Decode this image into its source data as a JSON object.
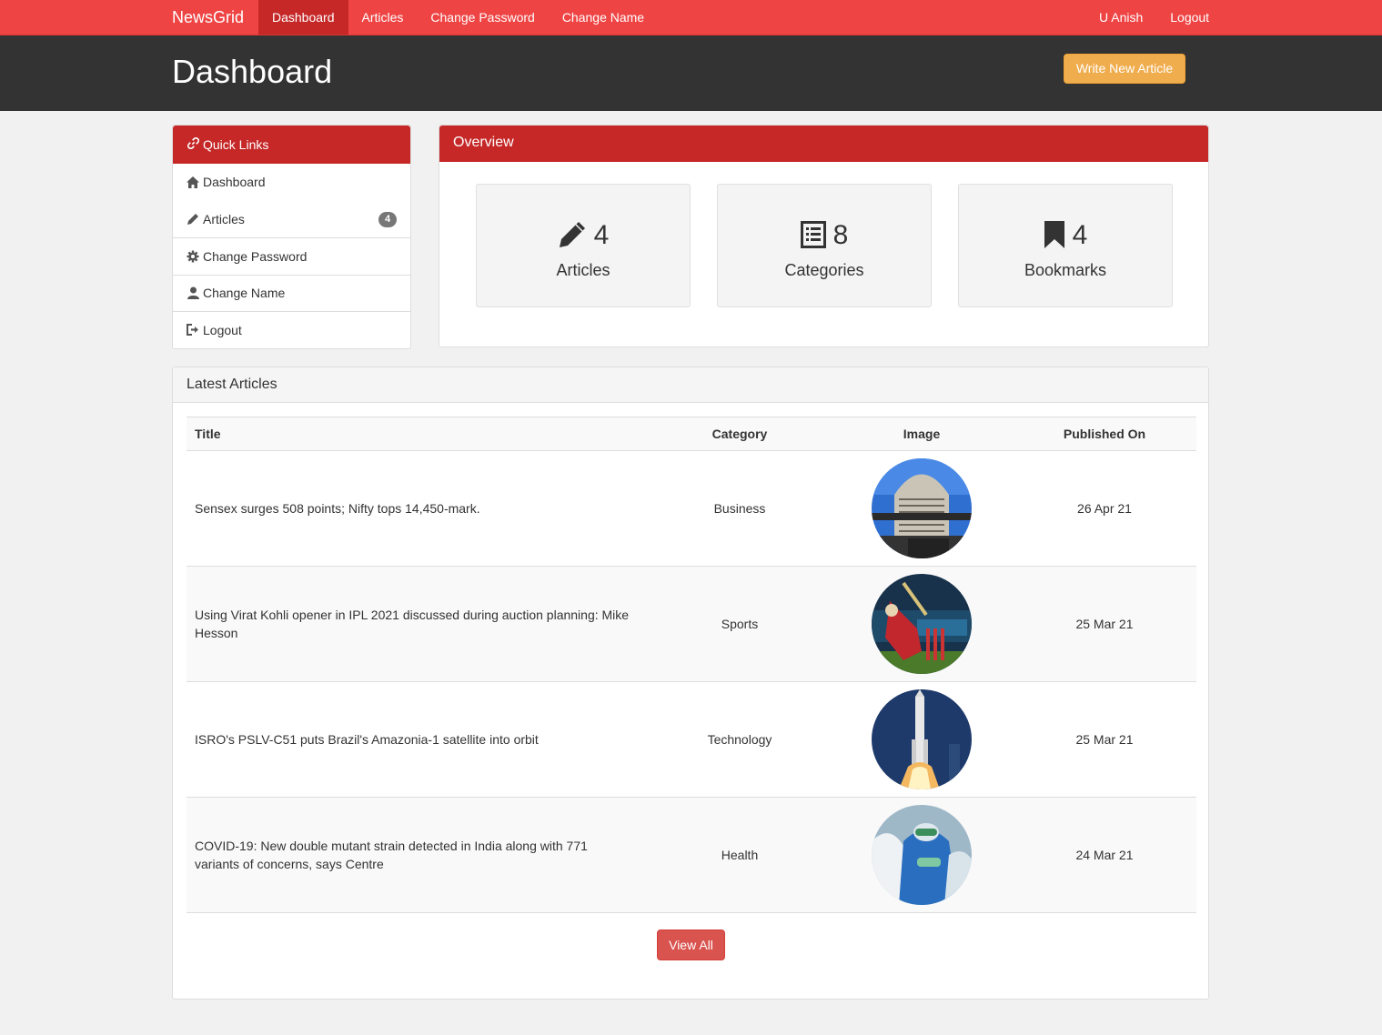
{
  "navbar": {
    "brand": "NewsGrid",
    "links": [
      "Dashboard",
      "Articles",
      "Change Password",
      "Change Name"
    ],
    "user": "U Anish",
    "logout": "Logout"
  },
  "header": {
    "title": "Dashboard",
    "write_button": "Write New Article"
  },
  "quick_links": {
    "title": "Quick Links",
    "items": [
      {
        "label": "Dashboard",
        "icon": "home-icon"
      },
      {
        "label": "Articles",
        "icon": "pencil-icon",
        "badge": "4"
      },
      {
        "label": "Change Password",
        "icon": "gear-icon"
      },
      {
        "label": "Change Name",
        "icon": "user-icon"
      },
      {
        "label": "Logout",
        "icon": "logout-icon"
      }
    ]
  },
  "overview": {
    "title": "Overview",
    "cards": [
      {
        "count": "4",
        "label": "Articles",
        "icon": "pencil-icon"
      },
      {
        "count": "8",
        "label": "Categories",
        "icon": "list-icon"
      },
      {
        "count": "4",
        "label": "Bookmarks",
        "icon": "bookmark-icon"
      }
    ]
  },
  "latest": {
    "title": "Latest Articles",
    "columns": [
      "Title",
      "Category",
      "Image",
      "Published On"
    ],
    "rows": [
      {
        "title": "Sensex surges 508 points; Nifty tops 14,450-mark.",
        "category": "Business",
        "date": "26 Apr 21"
      },
      {
        "title": "Using Virat Kohli opener in IPL 2021 discussed during auction planning: Mike Hesson",
        "category": "Sports",
        "date": "25 Mar 21"
      },
      {
        "title": "ISRO's PSLV-C51 puts Brazil's Amazonia-1 satellite into orbit",
        "category": "Technology",
        "date": "25 Mar 21"
      },
      {
        "title": "COVID-19: New double mutant strain detected in India along with 771 variants of concerns, says Centre",
        "category": "Health",
        "date": "24 Mar 21"
      }
    ],
    "view_all": "View All"
  },
  "colors": {
    "navbar": "#ef4444",
    "accent": "#c62828",
    "header": "#333333",
    "warning": "#f0ad4e",
    "danger": "#d9534f"
  }
}
